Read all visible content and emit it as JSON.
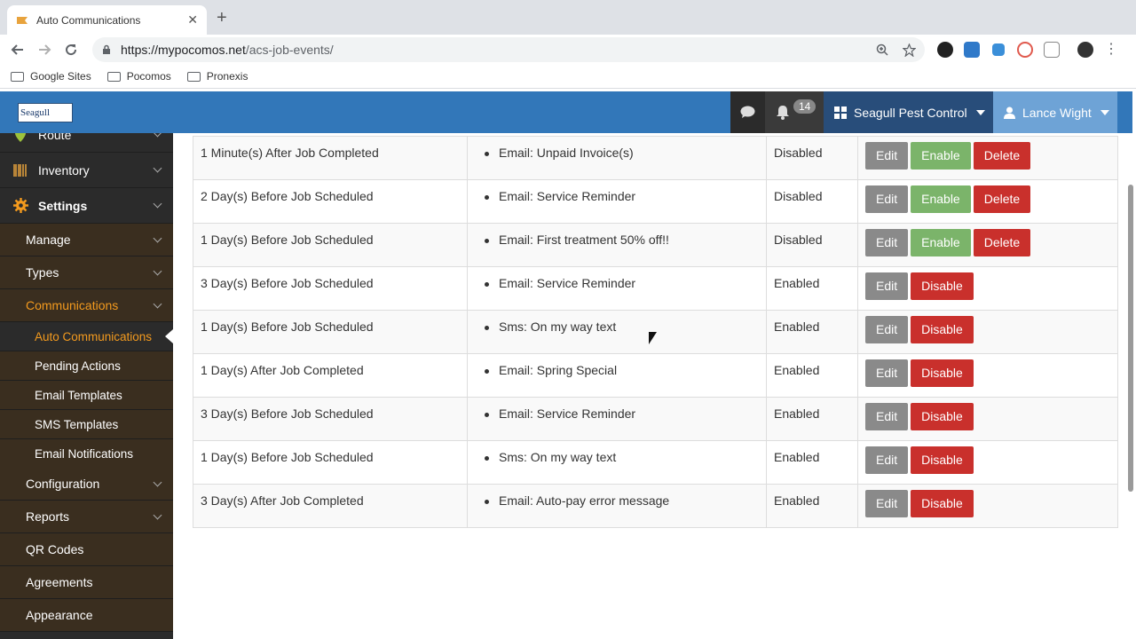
{
  "browser": {
    "tab_title": "Auto Communications",
    "url_host": "https://mypocomos.net",
    "url_path": "/acs-job-events/",
    "bookmarks": [
      "Google Sites",
      "Pocomos",
      "Pronexis"
    ]
  },
  "header": {
    "logo_text": "Seagull",
    "notification_count": "14",
    "company": "Seagull Pest Control",
    "user": "Lance Wight"
  },
  "sidebar": {
    "top_items": [
      "Route",
      "Inventory",
      "Settings"
    ],
    "sub_items": [
      "Manage",
      "Types",
      "Communications"
    ],
    "comm_items": [
      "Auto Communications",
      "Pending Actions",
      "Email Templates",
      "SMS Templates",
      "Email Notifications"
    ],
    "lower_items": [
      "Configuration",
      "Reports",
      "QR Codes",
      "Agreements",
      "Appearance"
    ]
  },
  "table": {
    "rows": [
      {
        "when": "1 Minute(s) After Job Completed",
        "action": "Email: Unpaid Invoice(s)",
        "status": "Disabled"
      },
      {
        "when": "2 Day(s) Before Job Scheduled",
        "action": "Email: Service Reminder",
        "status": "Disabled"
      },
      {
        "when": "1 Day(s) Before Job Scheduled",
        "action": "Email: First treatment 50% off!!",
        "status": "Disabled"
      },
      {
        "when": "3 Day(s) Before Job Scheduled",
        "action": "Email: Service Reminder",
        "status": "Enabled"
      },
      {
        "when": "1 Day(s) Before Job Scheduled",
        "action": "Sms: On my way text",
        "status": "Enabled"
      },
      {
        "when": "1 Day(s) After Job Completed",
        "action": "Email: Spring Special",
        "status": "Enabled"
      },
      {
        "when": "3 Day(s) Before Job Scheduled",
        "action": "Email: Service Reminder",
        "status": "Enabled"
      },
      {
        "when": "1 Day(s) Before Job Scheduled",
        "action": "Sms: On my way text",
        "status": "Enabled"
      },
      {
        "when": "3 Day(s) After Job Completed",
        "action": "Email: Auto-pay error message",
        "status": "Enabled"
      }
    ],
    "labels": {
      "edit": "Edit",
      "enable": "Enable",
      "delete": "Delete",
      "disable": "Disable"
    }
  }
}
